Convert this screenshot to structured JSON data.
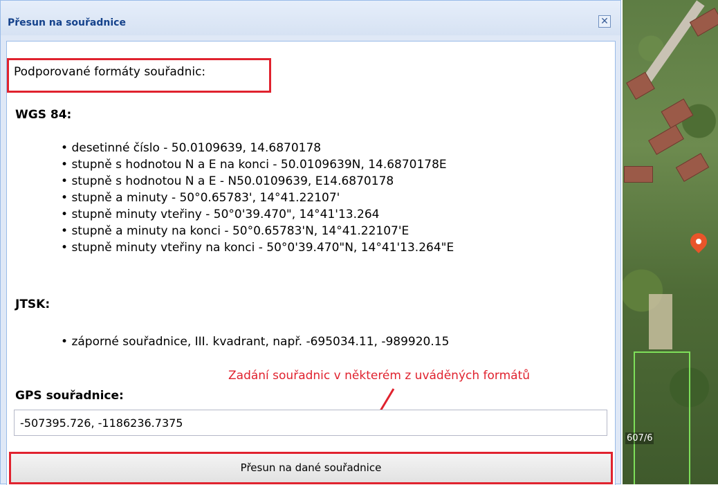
{
  "dialog": {
    "title": "Přesun na souřadnice",
    "close_glyph": "✕"
  },
  "formats": {
    "heading": "Podporované formáty souřadnic:",
    "wgs84": {
      "label": "WGS 84:",
      "items": [
        "desetinné číslo - 50.0109639, 14.6870178",
        "stupně s hodnotou N a E na konci - 50.0109639N, 14.6870178E",
        "stupně s hodnotou N a E - N50.0109639, E14.6870178",
        "stupně a minuty - 50°0.65783', 14°41.22107'",
        "stupně minuty vteřiny - 50°0'39.470\", 14°41'13.264",
        "stupně a minuty na konci - 50°0.65783'N, 14°41.22107'E",
        "stupně minuty vteřiny na konci - 50°0'39.470\"N, 14°41'13.264\"E"
      ]
    },
    "jtsk": {
      "label": "JTSK:",
      "items": [
        "záporné souřadnice, III. kvadrant, např. -695034.11, -989920.15"
      ]
    }
  },
  "annotation": {
    "hint": "Zadání souřadnic v některém z uváděných formátů",
    "color": "#e0222e"
  },
  "gps": {
    "label": "GPS souřadnice:",
    "value": "-507395.726, -1186236.7375"
  },
  "submit": {
    "label": "Přesun na dané souřadnice"
  },
  "map": {
    "parcel_label": "607/6",
    "pin_color": "#e8552a"
  }
}
